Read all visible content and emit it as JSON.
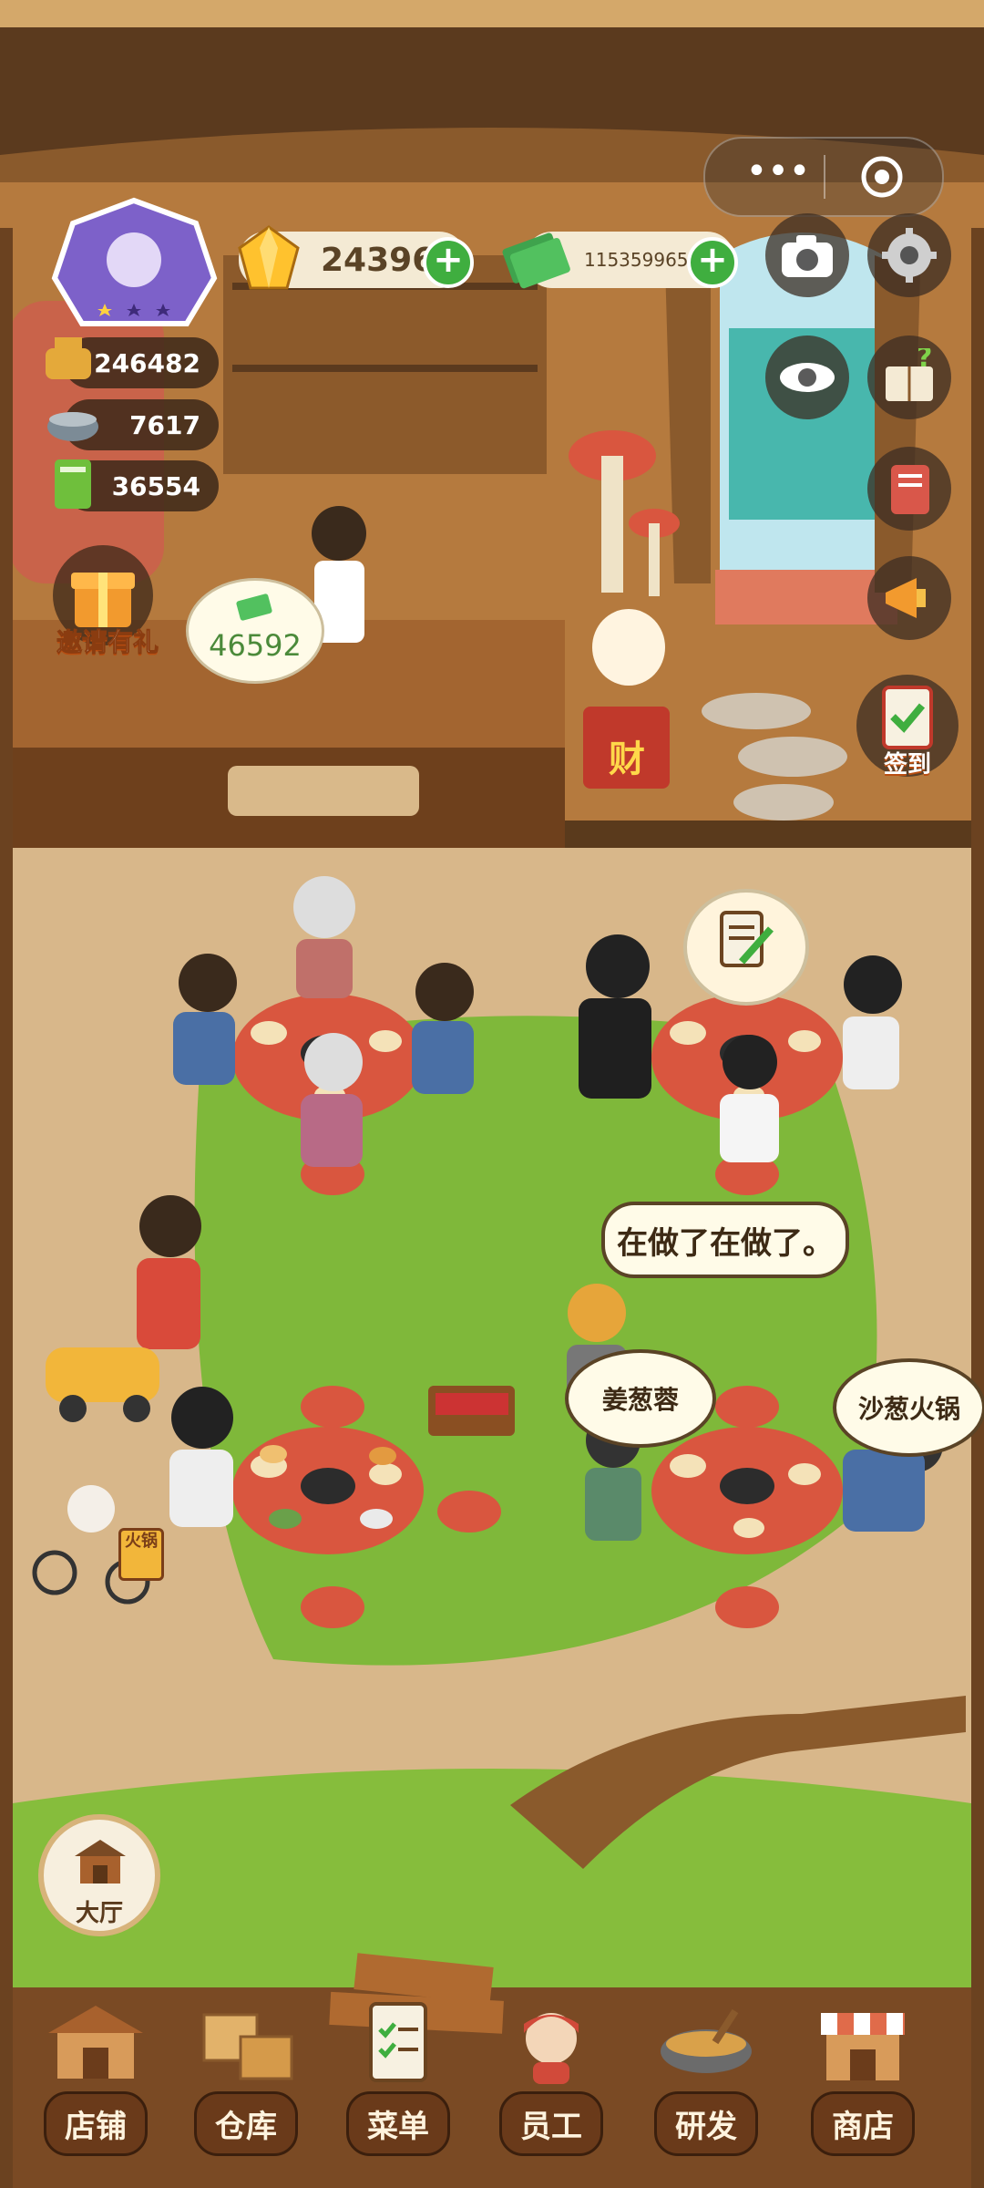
{
  "hud": {
    "gems": "24396",
    "money": "1153599659",
    "stat1": "246482",
    "stat2": "7617",
    "stat3": "36554",
    "invite_label": "邀请有礼",
    "counter_cash": "46592",
    "checkin_label": "签到",
    "fortune_char": "财"
  },
  "bubbles": {
    "waiter_speech": "在做了在做了。",
    "order1": "姜葱蓉",
    "order2": "沙葱火锅"
  },
  "hall_button": "大厅",
  "nav": [
    {
      "label": "店铺"
    },
    {
      "label": "仓库"
    },
    {
      "label": "菜单"
    },
    {
      "label": "员工"
    },
    {
      "label": "研发"
    },
    {
      "label": "商店"
    }
  ],
  "bike_sign": "火锅",
  "icons": [
    "more-dots-icon",
    "target-icon",
    "camera-icon",
    "gear-icon",
    "eye-icon",
    "help-book-icon",
    "notebook-icon",
    "megaphone-icon",
    "gem-icon",
    "cash-icon"
  ]
}
